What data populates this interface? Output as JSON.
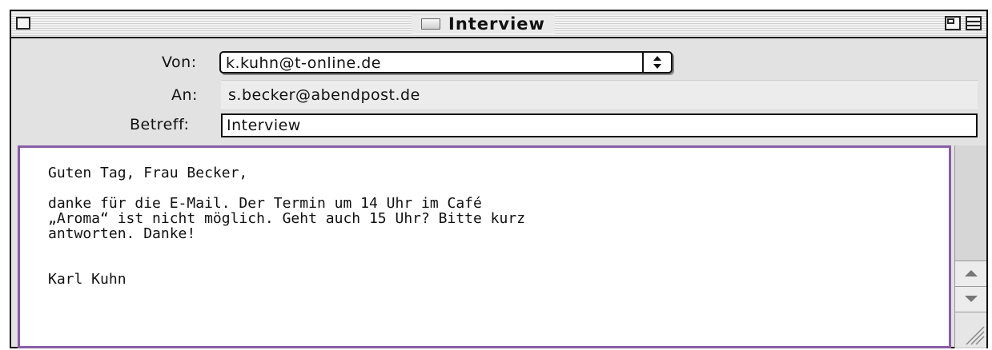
{
  "window": {
    "title": "Interview"
  },
  "header": {
    "from_label": "Von:",
    "from_value": "k.kuhn@t-online.de",
    "to_label": "An:",
    "to_value": "s.becker@abendpost.de",
    "subject_label": "Betreff:",
    "subject_value": "Interview"
  },
  "body": {
    "text": "Guten Tag, Frau Becker,\n\ndanke für die E-Mail. Der Termin um 14 Uhr im Café\n„Aroma“ ist nicht möglich. Geht auch 15 Uhr? Bitte kurz\nantworten. Danke!\n\n\nKarl Kuhn"
  },
  "icons": {
    "close": "close-box-icon",
    "document": "document-icon",
    "zoom": "zoom-box-icon",
    "collapse": "collapse-box-icon",
    "select_arrows": "up-down-arrows-icon",
    "scroll_up": "scroll-up-arrow-icon",
    "scroll_down": "scroll-down-arrow-icon",
    "resize": "resize-grip-icon"
  },
  "colors": {
    "body_border": "#8a5ca6",
    "window_bg": "#e2e2e2"
  }
}
